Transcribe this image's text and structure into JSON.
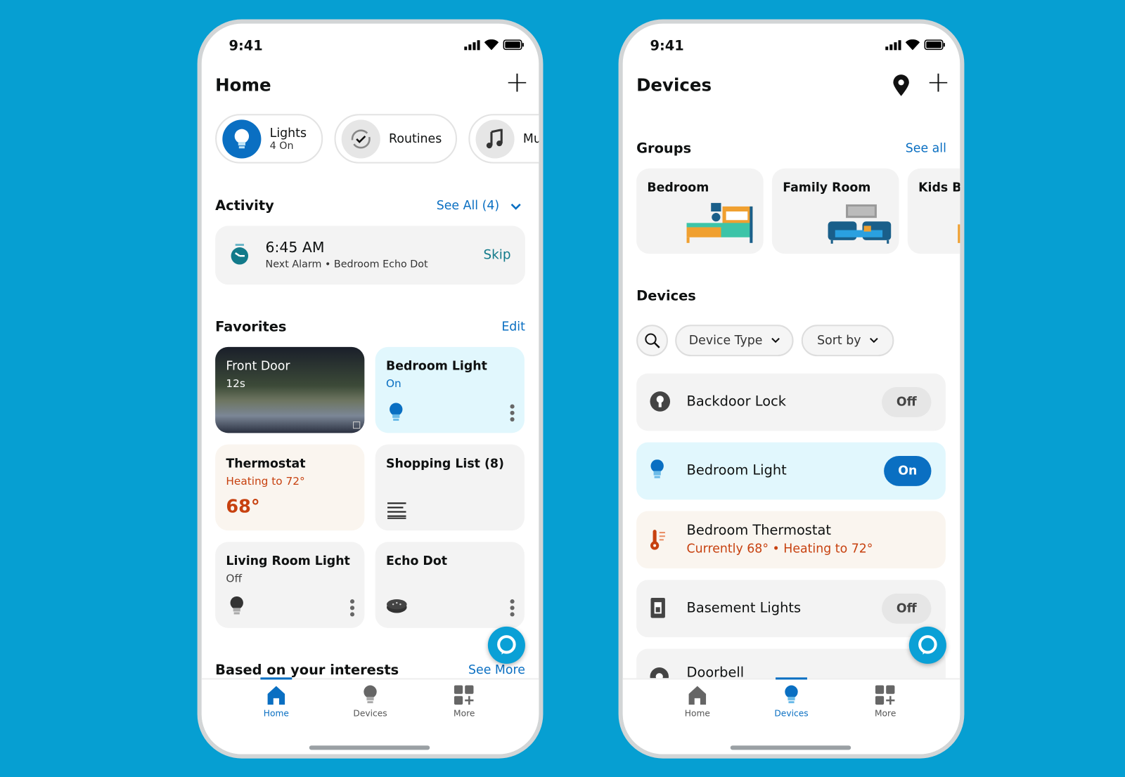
{
  "colors": {
    "background": "#069fd2",
    "accent": "#0a6fc2",
    "alexa": "#0aa0d6",
    "heating": "#c7410f",
    "light_on_bg": "#e1f7fd",
    "thermo_bg": "#faf5ef"
  },
  "home": {
    "status_time": "9:41",
    "title": "Home",
    "add_icon": "plus-icon",
    "chips": [
      {
        "label": "Lights",
        "sub": "4 On",
        "icon": "lightbulb-icon"
      },
      {
        "label": "Routines",
        "icon": "routines-icon"
      },
      {
        "label": "Mu",
        "icon": "music-note-icon"
      }
    ],
    "activity": {
      "title": "Activity",
      "see_all": "See All (4)",
      "alarm_time": "6:45 AM",
      "alarm_detail": "Next Alarm • Bedroom Echo Dot",
      "skip": "Skip"
    },
    "favorites": {
      "title": "Favorites",
      "edit": "Edit",
      "tiles": [
        {
          "title": "Front Door",
          "sub": "12s"
        },
        {
          "title": "Bedroom Light",
          "sub": "On"
        },
        {
          "title": "Thermostat",
          "sub": "Heating to 72°",
          "value": "68°"
        },
        {
          "title": "Shopping List (8)"
        },
        {
          "title": "Living Room Light",
          "sub": "Off"
        },
        {
          "title": "Echo Dot"
        }
      ]
    },
    "interests": {
      "title": "Based on your interests",
      "see_more": "See More"
    }
  },
  "devices_screen": {
    "status_time": "9:41",
    "title": "Devices",
    "groups": {
      "title": "Groups",
      "see_all": "See all",
      "items": [
        "Bedroom",
        "Family Room",
        "Kids Be"
      ]
    },
    "devices_title": "Devices",
    "filters": {
      "device_type": "Device Type",
      "sort_by": "Sort by"
    },
    "rows": [
      {
        "name": "Backdoor Lock",
        "state": "Off"
      },
      {
        "name": "Bedroom Light",
        "state": "On"
      },
      {
        "name": "Bedroom Thermostat",
        "detail": "Currently 68° • Heating to 72°"
      },
      {
        "name": "Basement Lights",
        "state": "Off"
      },
      {
        "name": "Doorbell"
      }
    ]
  },
  "nav": {
    "items": [
      "Home",
      "Devices",
      "More"
    ]
  }
}
